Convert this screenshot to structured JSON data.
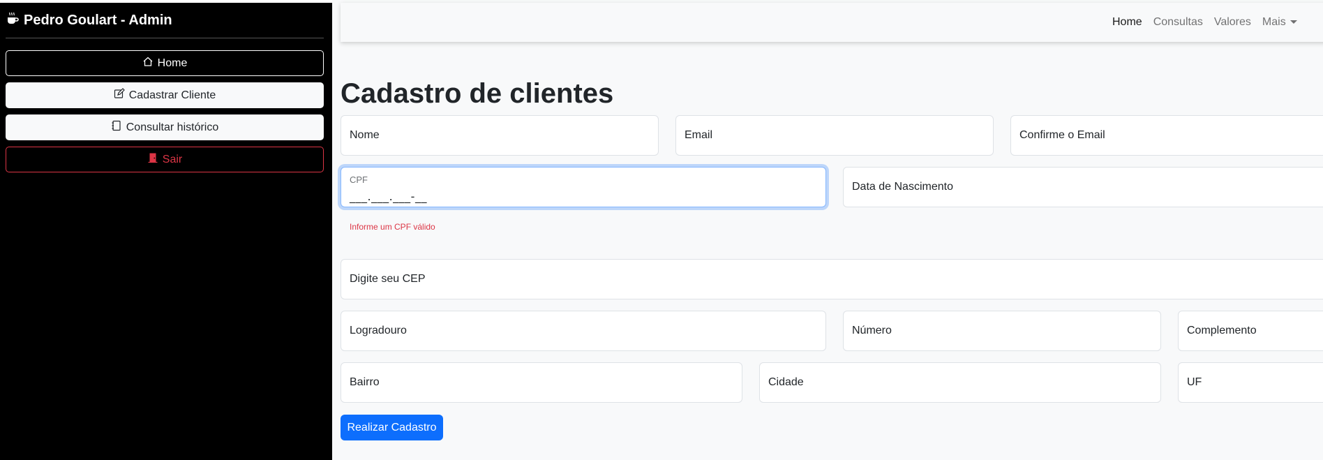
{
  "sidebar": {
    "brand": "Pedro Goulart - Admin",
    "brand_icon": "coffee-icon",
    "items": [
      {
        "label": "Home",
        "icon": "house-icon"
      },
      {
        "label": "Cadastrar Cliente",
        "icon": "pencil-square-icon"
      },
      {
        "label": "Consultar histórico",
        "icon": "journal-icon"
      },
      {
        "label": "Sair",
        "icon": "door-icon"
      }
    ]
  },
  "navbar": {
    "links": [
      "Home",
      "Consultas",
      "Valores",
      "Mais"
    ]
  },
  "page": {
    "title": "Cadastro de clientes"
  },
  "form": {
    "nome": "Nome",
    "email": "Email",
    "confirm_email": "Confirme o Email",
    "cpf_label": "CPF",
    "cpf_value": "___.___.___-__",
    "cpf_error": "Informe um CPF válido",
    "nascimento": "Data de Nascimento",
    "cep": "Digite seu CEP",
    "logradouro": "Logradouro",
    "numero": "Número",
    "complemento": "Complemento",
    "bairro": "Bairro",
    "cidade": "Cidade",
    "uf": "UF",
    "submit": "Realizar Cadastro"
  },
  "colors": {
    "sidebar_bg": "#000000",
    "primary": "#0d6efd",
    "danger": "#dc3545",
    "main_bg": "#f8f9fa"
  }
}
